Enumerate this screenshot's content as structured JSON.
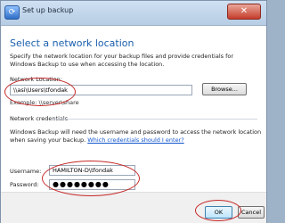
{
  "window": {
    "title": "Set up backup",
    "close_glyph": "✕"
  },
  "heading": "Select a network location",
  "description": "Specify the network location for your backup files and provide credentials for Windows Backup to use when accessing the location.",
  "network_location": {
    "label": "Network Location:",
    "value": "\\\\asi\\Users\\tfondak",
    "browse_label": "Browse...",
    "example": "Example: \\\\server\\share"
  },
  "credentials": {
    "section_title": "Network credentials",
    "description": "Windows Backup will need the username and password to access the network location when saving your backup.",
    "link_text": "Which credentials should I enter?",
    "username_label": "Username:",
    "username_value": "HAMILTON-D\\tfondak",
    "password_label": "Password:",
    "password_mask": "●●●●●●●●"
  },
  "footer": {
    "ok_label": "OK",
    "cancel_label": "Cancel"
  },
  "colors": {
    "annotation": "#c62828",
    "heading": "#1b5fae",
    "link": "#1155cc"
  },
  "icons": {
    "window_icon": "backup-icon",
    "close": "close-icon"
  }
}
